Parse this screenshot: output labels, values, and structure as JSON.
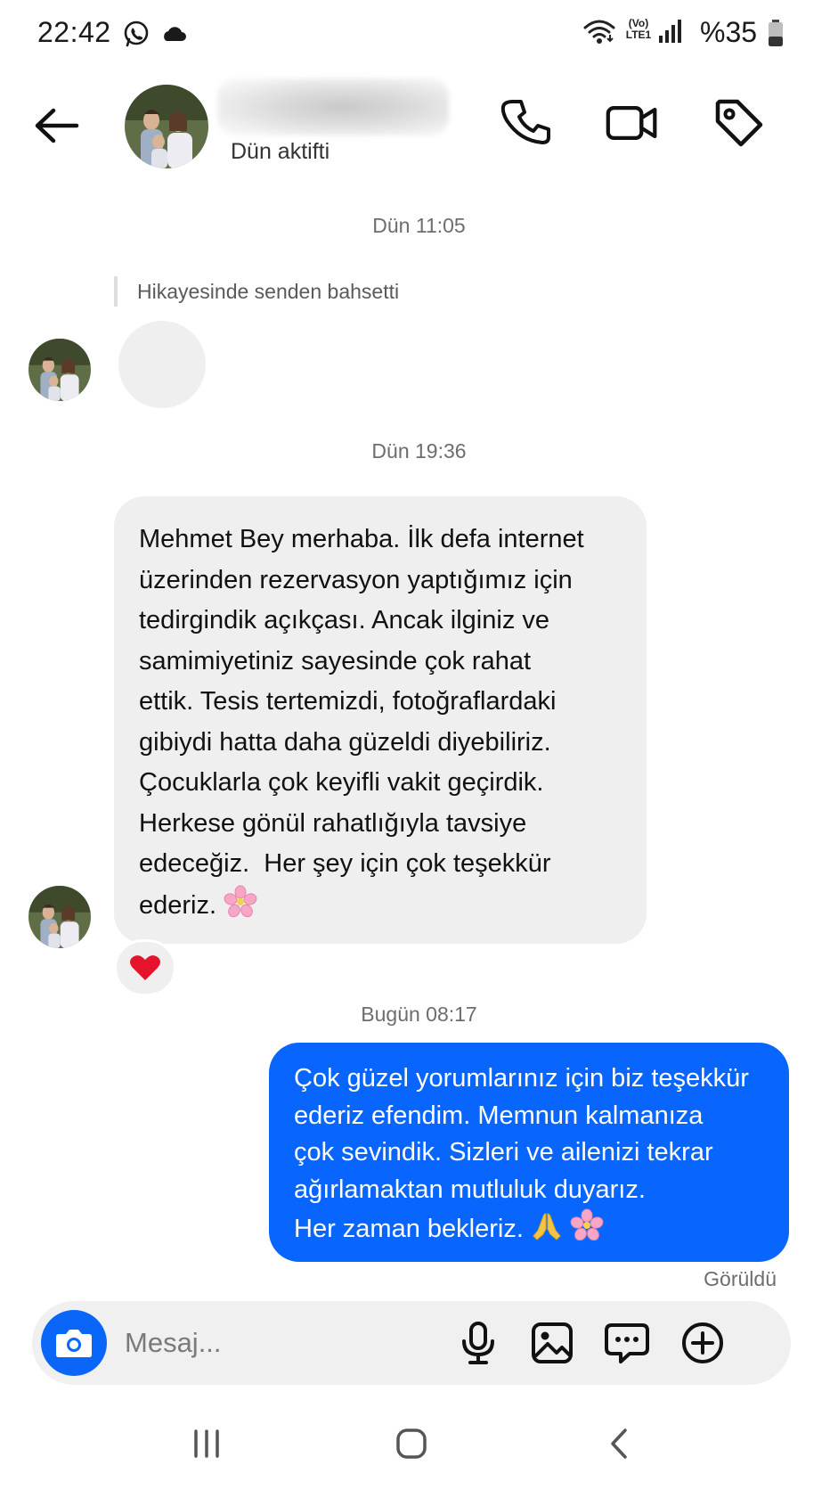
{
  "status_bar": {
    "time": "22:42",
    "network_label": "(Vo) LTE1",
    "battery_text": "%35"
  },
  "header": {
    "contact_name_hidden": true,
    "contact_status": "Dün aktifti"
  },
  "conversation": {
    "separators": [
      "Dün 11:05",
      "Dün 19:36",
      "Bugün 08:17"
    ],
    "story_mention": "Hikayesinde senden bahsetti",
    "incoming_message": {
      "lines": [
        "Mehmet Bey merhaba. İlk defa internet",
        "üzerinden rezervasyon yaptığımız için",
        "tedirgindik açıkçası. Ancak ilginiz ve",
        "samimiyetiniz sayesinde çok rahat",
        "ettik. Tesis tertemizdi, fotoğraflardaki",
        "gibiydi hatta daha güzeldi diyebiliriz.",
        "Çocuklarla çok keyifli vakit geçirdik.",
        "Herkese gönül rahatlığıyla tavsiye",
        "edeceğiz.  Her şey için çok teşekkür",
        "ederiz."
      ],
      "trailing_emoji": "cherry-blossom",
      "reaction": "red-heart"
    },
    "outgoing_message": {
      "lines": [
        "Çok güzel yorumlarınız için biz teşekkür",
        "ederiz efendim. Memnun kalmanıza",
        "çok sevindik. Sizleri ve ailenizi tekrar",
        "ağırlamaktan mutluluk duyarız.",
        "Her zaman bekleriz."
      ],
      "trailing_emojis": [
        "folded-hands",
        "cherry-blossom"
      ],
      "bubble_color": "#0866ff"
    },
    "seen_label": "Görüldü"
  },
  "composer": {
    "placeholder": "Mesaj..."
  },
  "colors": {
    "accent_blue": "#0866ff",
    "incoming_bubble": "#efefef",
    "heart_red": "#e5132b"
  }
}
